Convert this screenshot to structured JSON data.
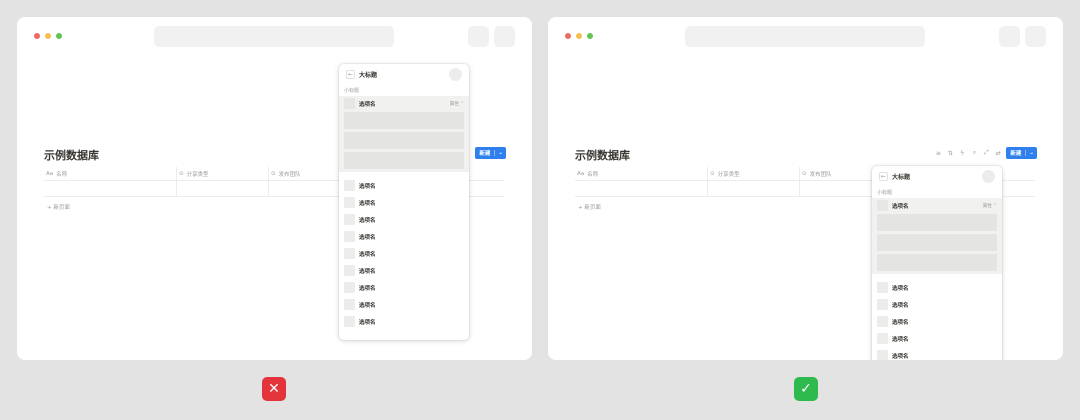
{
  "colors": {
    "accent": "#2f80ed",
    "dot_red": "#ed6a5e",
    "dot_yellow": "#f5bf4f",
    "dot_green": "#61c554",
    "bad": "#e3343b",
    "good": "#2fba4d"
  },
  "database": {
    "title": "示例数据库",
    "columns": [
      {
        "icon": "text-icon",
        "glyph": "Aa",
        "label": "名称"
      },
      {
        "icon": "select-icon",
        "glyph": "⊙",
        "label": "分享类型"
      },
      {
        "icon": "select-icon",
        "glyph": "⊙",
        "label": "发布团队"
      }
    ],
    "new_page": "+ 新页面",
    "new_button": "新建",
    "new_button_chevron": "⌄"
  },
  "toolbar_icons": [
    {
      "name": "filter-icon",
      "glyph": "≡"
    },
    {
      "name": "sort-icon",
      "glyph": "⇅"
    },
    {
      "name": "bolt-icon",
      "glyph": "ϟ"
    },
    {
      "name": "search-icon",
      "glyph": "⌕"
    },
    {
      "name": "expand-icon",
      "glyph": "⤢"
    },
    {
      "name": "settings-icon",
      "glyph": "⇄"
    }
  ],
  "menu": {
    "back": "←",
    "title": "大标题",
    "subtitle": "小标题",
    "selected_option": "选项名",
    "property": "属性 ⌃",
    "options": [
      "选项名",
      "选项名",
      "选项名",
      "选项名",
      "选项名",
      "选项名",
      "选项名",
      "选项名",
      "选项名"
    ],
    "options_right": [
      "选项名",
      "选项名",
      "选项名",
      "选项名",
      "选项名"
    ]
  },
  "badges": {
    "bad": "✕",
    "good": "✓"
  }
}
